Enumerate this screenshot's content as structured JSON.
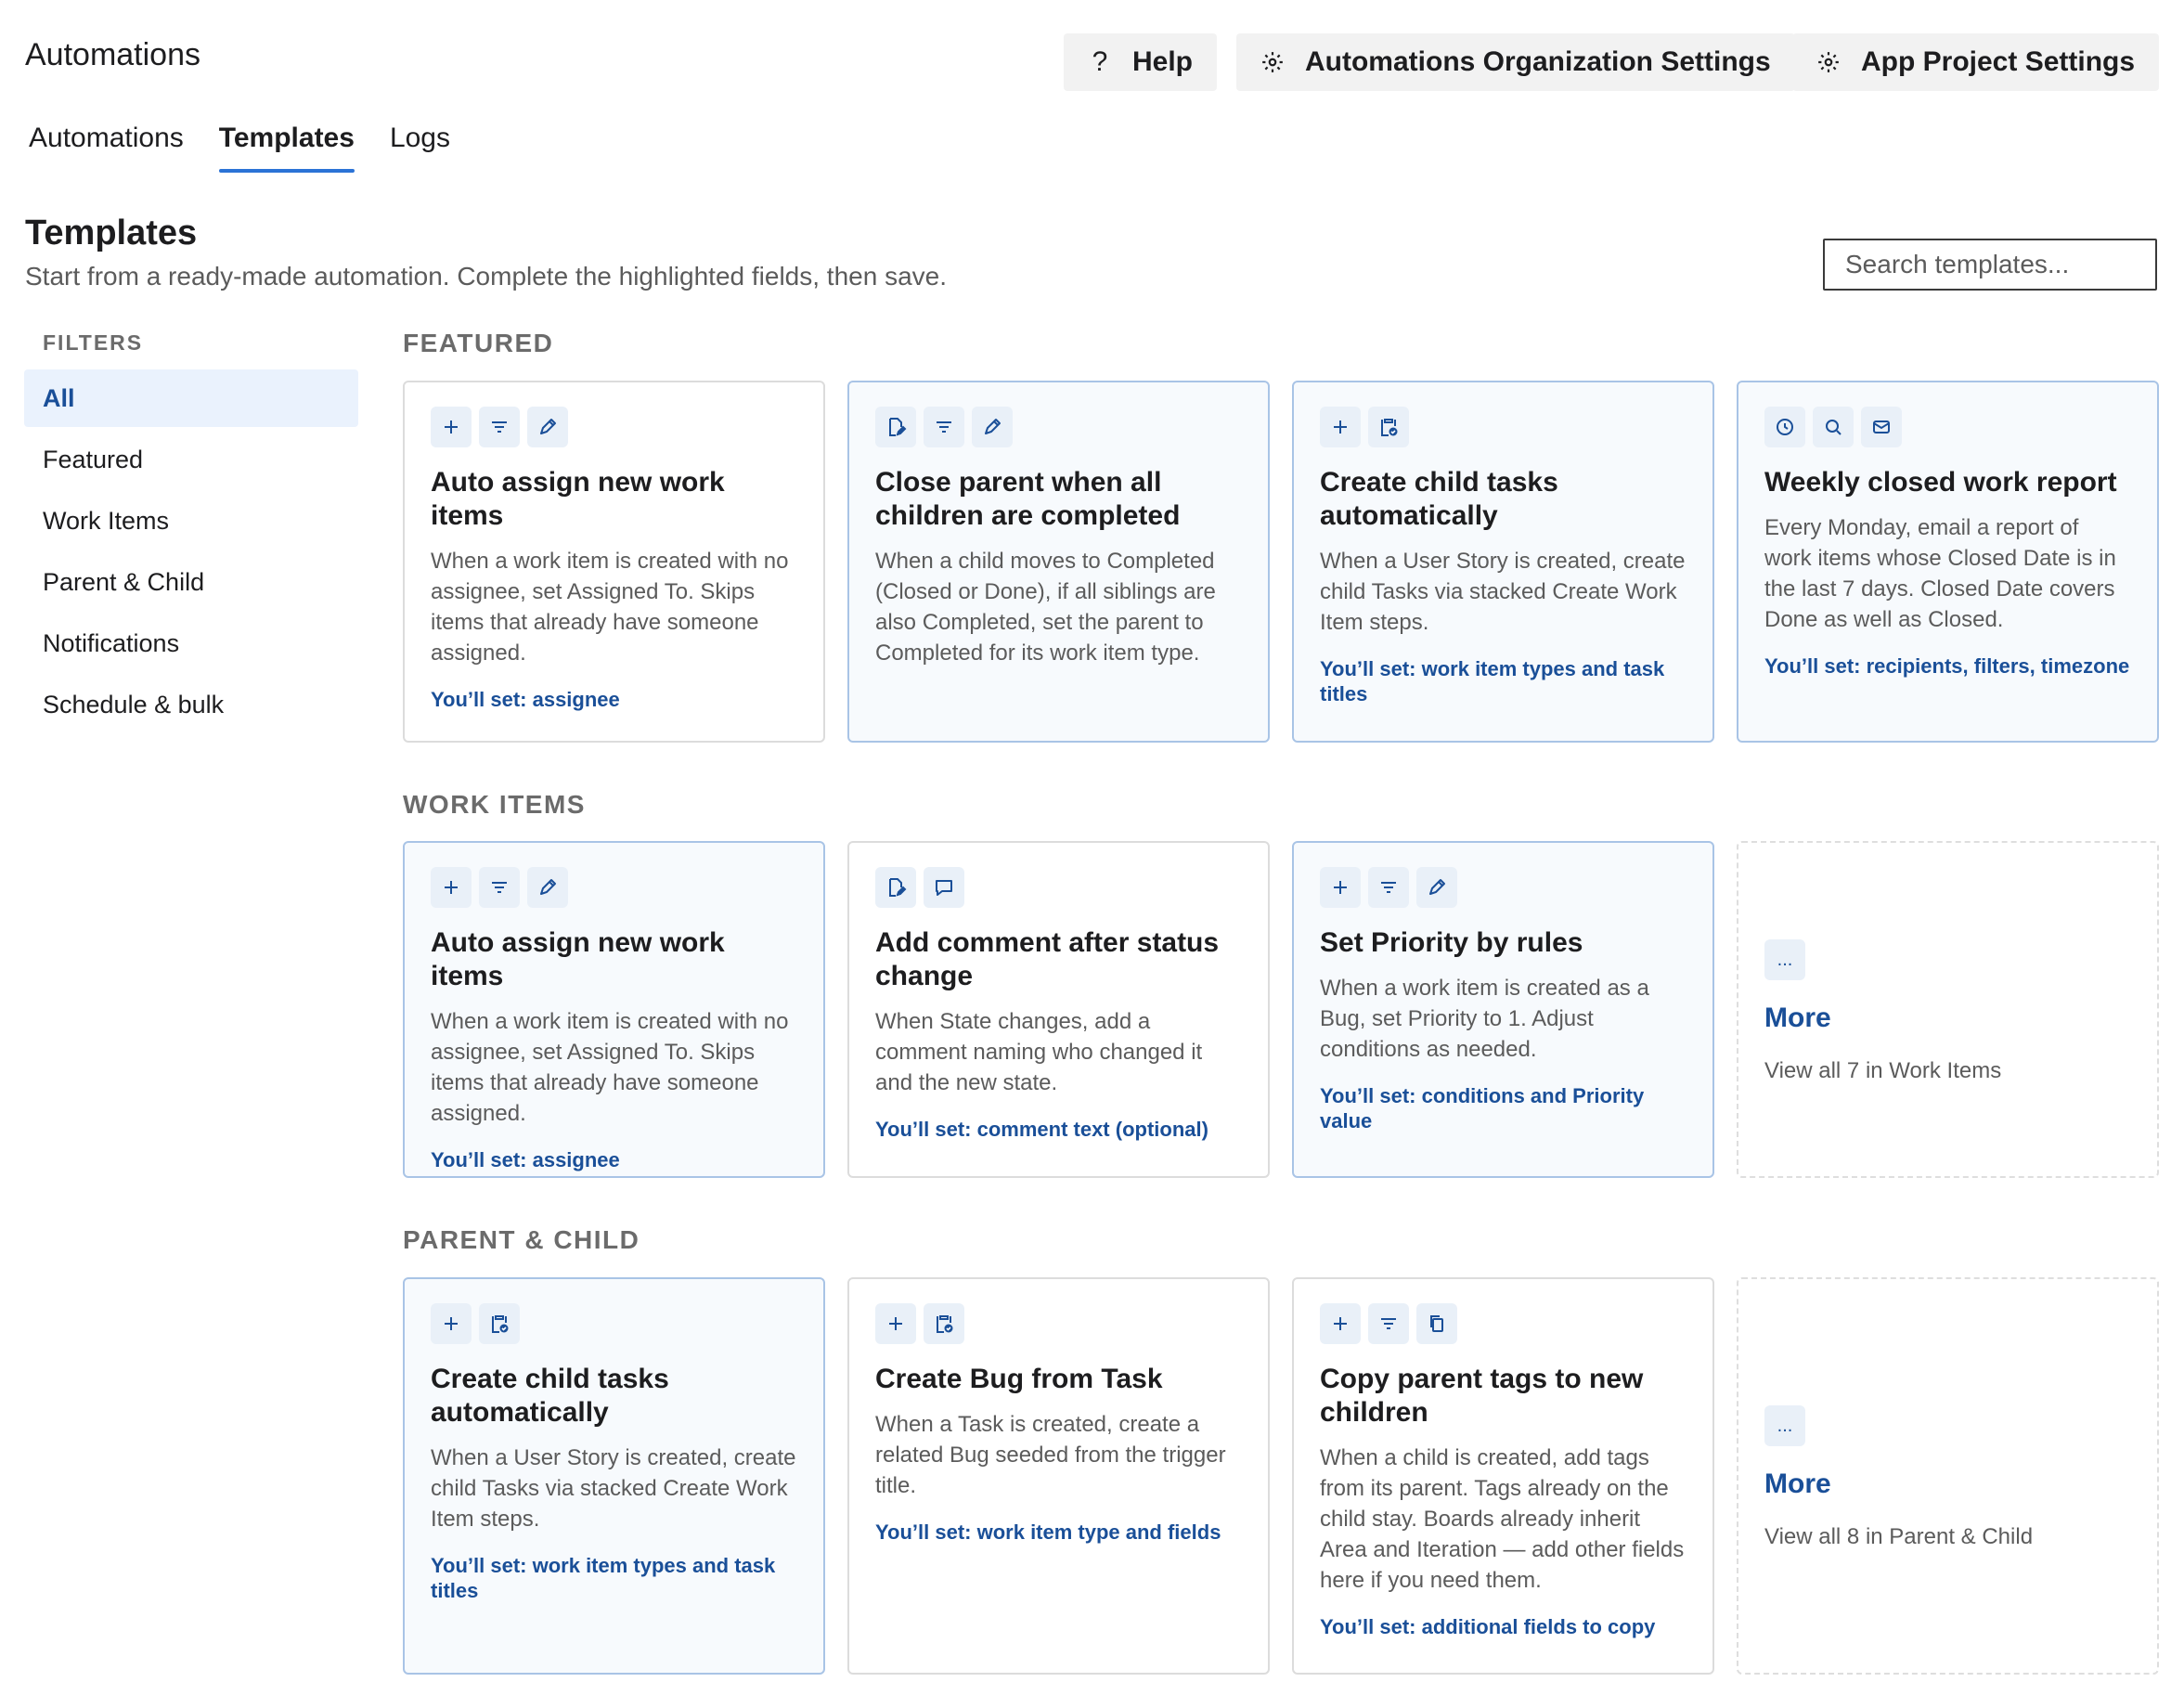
{
  "header": {
    "title": "Automations",
    "help_label": "Help",
    "org_settings_label": "Automations Organization Settings",
    "project_settings_label": "App Project Settings"
  },
  "tabs": [
    {
      "label": "Automations",
      "active": false
    },
    {
      "label": "Templates",
      "active": true
    },
    {
      "label": "Logs",
      "active": false
    }
  ],
  "page": {
    "title": "Templates",
    "subtitle": "Start from a ready-made automation. Complete the highlighted fields, then save.",
    "search_placeholder": "Search templates..."
  },
  "filters": {
    "heading": "FILTERS",
    "items": [
      "All",
      "Featured",
      "Work Items",
      "Parent & Child",
      "Notifications",
      "Schedule & bulk"
    ],
    "active": "All"
  },
  "sections": {
    "featured": {
      "heading": "FEATURED",
      "cards": [
        {
          "title": "Auto assign new work items",
          "desc": "When a work item is created with no assignee, set Assigned To. Skips items that already have someone assigned.",
          "set": "You’ll set: assignee",
          "icons": [
            "plus-icon",
            "filter-icon",
            "pencil-icon"
          ]
        },
        {
          "title": "Close parent when all children are completed",
          "desc": "When a child moves to Completed (Closed or Done), if all siblings are also Completed, set the parent to Completed for its work item type.",
          "set": "",
          "icons": [
            "edit-doc-icon",
            "filter-icon",
            "pencil-icon"
          ]
        },
        {
          "title": "Create child tasks automatically",
          "desc": "When a User Story is created, create child Tasks via stacked Create Work Item steps.",
          "set": "You’ll set: work item types and task titles",
          "icons": [
            "plus-icon",
            "clipboard-check-icon"
          ]
        },
        {
          "title": "Weekly closed work report",
          "desc": "Every Monday, email a report of work items whose Closed Date is in the last 7 days. Closed Date covers Done as well as Closed.",
          "set": "You’ll set: recipients, filters, timezone",
          "icons": [
            "clock-icon",
            "search-icon",
            "mail-icon"
          ]
        }
      ]
    },
    "work_items": {
      "heading": "WORK ITEMS",
      "cards": [
        {
          "title": "Auto assign new work items",
          "desc": "When a work item is created with no assignee, set Assigned To. Skips items that already have someone assigned.",
          "set": "You’ll set: assignee",
          "icons": [
            "plus-icon",
            "filter-icon",
            "pencil-icon"
          ]
        },
        {
          "title": "Add comment after status change",
          "desc": "When State changes, add a comment naming who changed it and the new state.",
          "set": "You’ll set: comment text (optional)",
          "icons": [
            "edit-doc-icon",
            "comment-icon"
          ]
        },
        {
          "title": "Set Priority by rules",
          "desc": "When a work item is created as a Bug, set Priority to 1. Adjust conditions as needed.",
          "set": "You’ll set: conditions and Priority value",
          "icons": [
            "plus-icon",
            "filter-icon",
            "pencil-icon"
          ]
        }
      ],
      "more": {
        "icon_label": "...",
        "title": "More",
        "sub": "View all 7 in Work Items"
      }
    },
    "parent_child": {
      "heading": "PARENT & CHILD",
      "cards": [
        {
          "title": "Create child tasks automatically",
          "desc": "When a User Story is created, create child Tasks via stacked Create Work Item steps.",
          "set": "You’ll set: work item types and task titles",
          "icons": [
            "plus-icon",
            "clipboard-check-icon"
          ]
        },
        {
          "title": "Create Bug from Task",
          "desc": "When a Task is created, create a related Bug seeded from the trigger title.",
          "set": "You’ll set: work item type and fields",
          "icons": [
            "plus-icon",
            "clipboard-check-icon"
          ]
        },
        {
          "title": "Copy parent tags to new children",
          "desc": "When a child is created, add tags from its parent. Tags already on the child stay. Boards already inherit Area and Iteration — add other fields here if you need them.",
          "set": "You’ll set: additional fields to copy",
          "icons": [
            "plus-icon",
            "filter-icon",
            "copy-icon"
          ]
        }
      ],
      "more": {
        "icon_label": "...",
        "title": "More",
        "sub": "View all 8 in Parent & Child"
      }
    }
  },
  "colors": {
    "accent": "#2b73d6",
    "link": "#1a4f98",
    "highlight_bg": "#f7fafd",
    "filter_active_bg": "#eaf2fd"
  }
}
